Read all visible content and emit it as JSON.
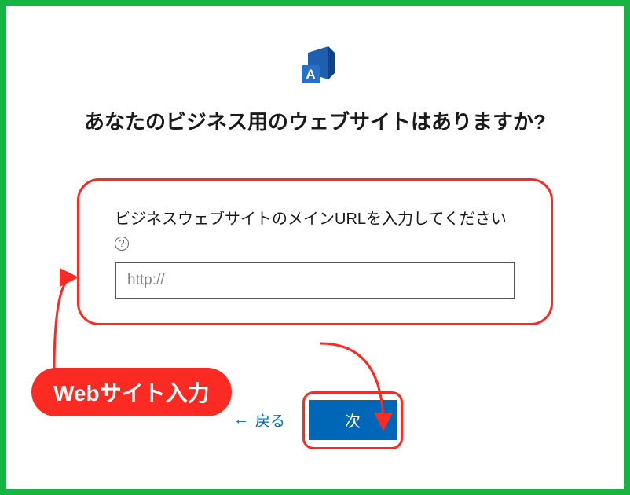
{
  "heading": "あなたのビジネス用のウェブサイトはありますか?",
  "form": {
    "label": "ビジネスウェブサイトのメインURLを入力してください",
    "placeholder": "http://"
  },
  "callout": "Webサイト入力",
  "buttons": {
    "back": "戻る",
    "next": "次"
  },
  "icons": {
    "megaphone": "megaphone-icon",
    "help": "?",
    "backArrow": "←"
  },
  "colors": {
    "frame": "#15b542",
    "annotation": "#fb2b23",
    "primary": "#0067b8"
  }
}
